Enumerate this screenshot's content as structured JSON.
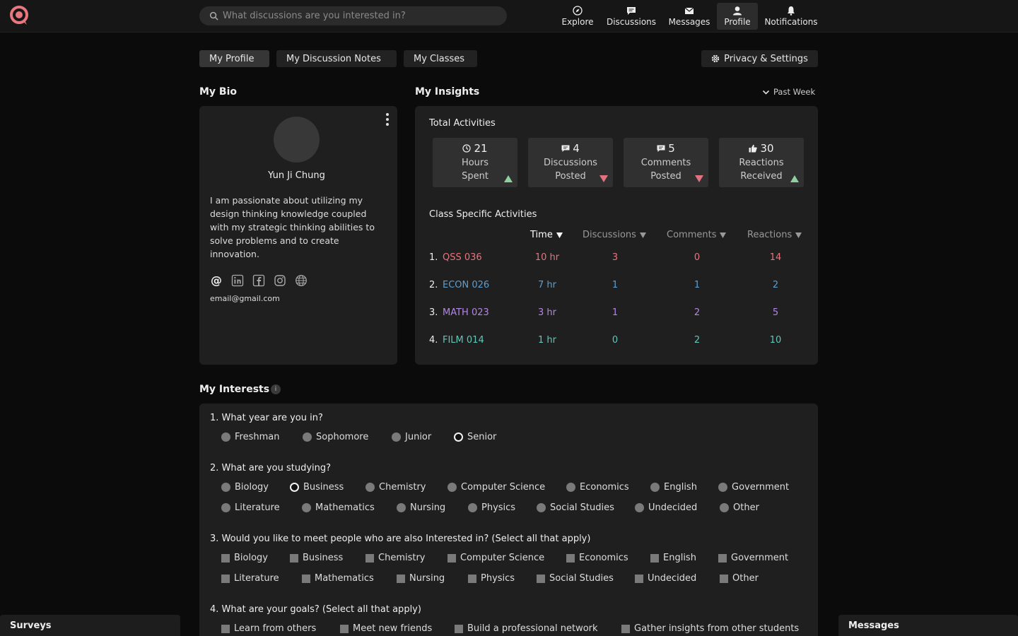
{
  "colors": {
    "brand": "#e9777f",
    "qss": "#e8737d",
    "econ": "#5c9fd1",
    "math": "#b386e6",
    "film": "#5fc8b8",
    "trend_up": "#8fd19e",
    "trend_down": "#e0737f"
  },
  "header": {
    "search_placeholder": "What discussions are you interested in?",
    "nav": [
      {
        "label": "Explore",
        "icon": "compass-icon"
      },
      {
        "label": "Discussions",
        "icon": "chat-icon"
      },
      {
        "label": "Messages",
        "icon": "envelope-icon"
      },
      {
        "label": "Profile",
        "icon": "user-icon",
        "active": true
      },
      {
        "label": "Notifications",
        "icon": "bell-icon"
      }
    ]
  },
  "tabs": [
    {
      "label": "My Profile",
      "active": true
    },
    {
      "label": "My Discussion Notes"
    },
    {
      "label": "My Classes"
    }
  ],
  "settings_label": "Privacy & Settings",
  "bio": {
    "title": "My Bio",
    "name": "Yun Ji Chung",
    "text": "I am passionate about utilizing my design thinking knowledge coupled with my strategic thinking abilities to solve problems and to create innovation.",
    "email": "email@gmail.com",
    "socials": [
      "at-icon",
      "linkedin-icon",
      "facebook-icon",
      "instagram-icon",
      "globe-icon"
    ]
  },
  "insights": {
    "title": "My Insights",
    "range": "Past Week",
    "total_title": "Total Activities",
    "stats": [
      {
        "value": "21",
        "line1": "Hours",
        "line2": "Spent",
        "icon": "clock-icon",
        "trend": "up"
      },
      {
        "value": "4",
        "line1": "Discussions",
        "line2": "Posted",
        "icon": "chat-icon",
        "trend": "down"
      },
      {
        "value": "5",
        "line1": "Comments",
        "line2": "Posted",
        "icon": "chat-icon",
        "trend": "down"
      },
      {
        "value": "30",
        "line1": "Reactions",
        "line2": "Received",
        "icon": "thumbs-up-icon",
        "trend": "up"
      }
    ],
    "class_title": "Class Specific Activities",
    "columns": [
      "Time",
      "Discussions",
      "Comments",
      "Reactions"
    ],
    "rows": [
      {
        "num": "1.",
        "class": "QSS 036",
        "time": "10 hr",
        "discussions": "3",
        "comments": "0",
        "reactions": "14"
      },
      {
        "num": "2.",
        "class": "ECON 026",
        "time": "7 hr",
        "discussions": "1",
        "comments": "1",
        "reactions": "2"
      },
      {
        "num": "3.",
        "class": "MATH 023",
        "time": "3 hr",
        "discussions": "1",
        "comments": "2",
        "reactions": "5"
      },
      {
        "num": "4.",
        "class": "FILM 014",
        "time": "1 hr",
        "discussions": "0",
        "comments": "2",
        "reactions": "10"
      }
    ]
  },
  "interests": {
    "title": "My Interests",
    "info": "i",
    "questions": [
      {
        "text": "1. What year are you in?",
        "options": [
          "Freshman",
          "Sophomore",
          "Junior",
          "Senior"
        ],
        "selected": "Senior"
      },
      {
        "text": "2. What are you studying?",
        "options": [
          "Biology",
          "Business",
          "Chemistry",
          "Computer Science",
          "Economics",
          "English",
          "Government",
          "Literature",
          "Mathematics",
          "Nursing",
          "Physics",
          "Social Studies",
          "Undecided",
          "Other"
        ],
        "selected": "Business"
      },
      {
        "text": "3. Would you like to meet people who are also Interested in? (Select all that apply)",
        "options": [
          "Biology",
          "Business",
          "Chemistry",
          "Computer Science",
          "Economics",
          "English",
          "Government",
          "Literature",
          "Mathematics",
          "Nursing",
          "Physics",
          "Social Studies",
          "Undecided",
          "Other"
        ]
      },
      {
        "text": "4. What are your goals? (Select all that apply)",
        "options": [
          "Learn from others",
          "Meet new friends",
          "Build a professional network",
          "Gather insights from other students"
        ]
      }
    ]
  },
  "dock": {
    "surveys": "Surveys",
    "messages": "Messages"
  }
}
